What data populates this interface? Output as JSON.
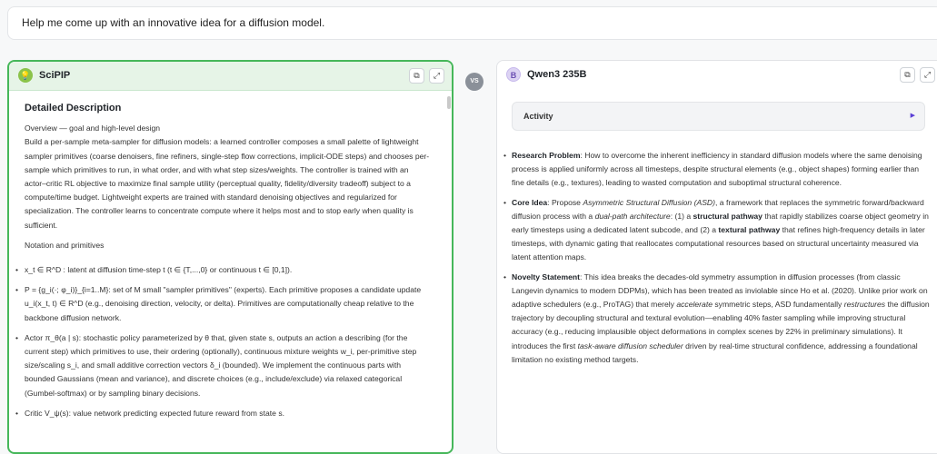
{
  "prompt": "Help me come up with an innovative idea for a diffusion model.",
  "vs_label": "VS",
  "left": {
    "model_name": "SciPIP",
    "avatar_icon": "lightbulb-icon",
    "title": "Detailed Description",
    "para1": "Overview — goal and high-level design",
    "para2": "Build a per-sample meta-sampler for diffusion models: a learned controller composes a small palette of lightweight sampler primitives (coarse denoisers, fine refiners, single-step flow corrections, implicit-ODE steps) and chooses per-sample which primitives to run, in what order, and with what step sizes/weights. The controller is trained with an actor–critic RL objective to maximize final sample utility (perceptual quality, fidelity/diversity tradeoff) subject to a compute/time budget. Lightweight experts are trained with standard denoising objectives and regularized for specialization. The controller learns to concentrate compute where it helps most and to stop early when quality is sufficient.",
    "para3": "Notation and primitives",
    "items": [
      "x_t ∈ R^D : latent at diffusion time-step t (t ∈ {T,...,0} or continuous t ∈ [0,1]).",
      "P = {g_i(·; φ_i)}_{i=1..M}: set of M small \"sampler primitives\" (experts). Each primitive proposes a candidate update u_i(x_t, t) ∈ R^D (e.g., denoising direction, velocity, or delta). Primitives are computationally cheap relative to the backbone diffusion network.",
      "Actor π_θ(a | s): stochastic policy parameterized by θ that, given state s, outputs an action a describing (for the current step) which primitives to use, their ordering (optionally), continuous mixture weights w_i, per-primitive step size/scaling s_i, and small additive correction vectors δ_i (bounded). We implement the continuous parts with bounded Gaussians (mean and variance), and discrete choices (e.g., include/exclude) via relaxed categorical (Gumbel-softmax) or by sampling binary decisions.",
      "Critic V_ψ(s): value network predicting expected future reward from state s."
    ]
  },
  "right": {
    "model_name": "Qwen3 235B",
    "avatar_letter": "B",
    "activity_label": "Activity",
    "p1_label": "Research Problem",
    "p1_text": ": How to overcome the inherent inefficiency in standard diffusion models where the same denoising process is applied uniformly across all timesteps, despite structural elements (e.g., object shapes) forming earlier than fine details (e.g., textures), leading to wasted computation and suboptimal structural coherence.",
    "p2_label": "Core Idea",
    "p2_a": ": Propose ",
    "p2_i1": "Asymmetric Structural Diffusion (ASD)",
    "p2_b": ", a framework that replaces the symmetric forward/backward diffusion process with a ",
    "p2_i2": "dual-path architecture",
    "p2_c": ": (1) a ",
    "p2_b1": "structural pathway",
    "p2_d": " that rapidly stabilizes coarse object geometry in early timesteps using a dedicated latent subcode, and (2) a ",
    "p2_b2": "textural pathway",
    "p2_e": " that refines high-frequency details in later timesteps, with dynamic gating that reallocates computational resources based on structural uncertainty measured via latent attention maps.",
    "p3_label": "Novelty Statement",
    "p3_a": ": This idea breaks the decades-old symmetry assumption in diffusion processes (from classic Langevin dynamics to modern DDPMs), which has been treated as inviolable since Ho et al. (2020). Unlike prior work on adaptive schedulers (e.g., ProTAG) that merely ",
    "p3_i1": "accelerate",
    "p3_b": " symmetric steps, ASD fundamentally ",
    "p3_i2": "restructures",
    "p3_c": " the diffusion trajectory by decoupling structural and textural evolution—enabling 40% faster sampling while improving structural accuracy (e.g., reducing implausible object deformations in complex scenes by 22% in preliminary simulations). It introduces the first ",
    "p3_i3": "task-aware diffusion scheduler",
    "p3_d": " driven by real-time structural confidence, addressing a foundational limitation no existing method targets."
  }
}
